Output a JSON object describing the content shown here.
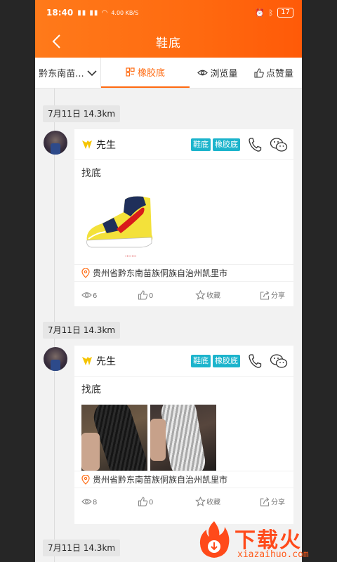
{
  "status": {
    "time": "18:40",
    "network": "4.00 KB/S",
    "battery": "17"
  },
  "header": {
    "title": "鞋底"
  },
  "filters": {
    "region": "黔东南苗...",
    "active_tab": "橡胶底",
    "views": "浏览量",
    "likes": "点赞量"
  },
  "posts": [
    {
      "date": "7月11日 14.3km",
      "user": "先生",
      "tags": [
        "鞋底",
        "橡胶底"
      ],
      "text": "找底",
      "location": "贵州省黔东南苗族侗族自治州凯里市",
      "views": "6",
      "likes": "0",
      "favorite_label": "收藏",
      "share_label": "分享"
    },
    {
      "date": "7月11日 14.3km",
      "user": "先生",
      "tags": [
        "鞋底",
        "橡胶底"
      ],
      "text": "找底",
      "location": "贵州省黔东南苗族侗族自治州凯里市",
      "views": "8",
      "likes": "0",
      "favorite_label": "收藏",
      "share_label": "分享"
    },
    {
      "date": "7月11日 14.3km"
    }
  ],
  "watermark": {
    "title": "下载火",
    "subtitle": "xiazaihuo.com"
  },
  "colors": {
    "accent": "#ff6a10",
    "tag": "#1cb4cc"
  }
}
